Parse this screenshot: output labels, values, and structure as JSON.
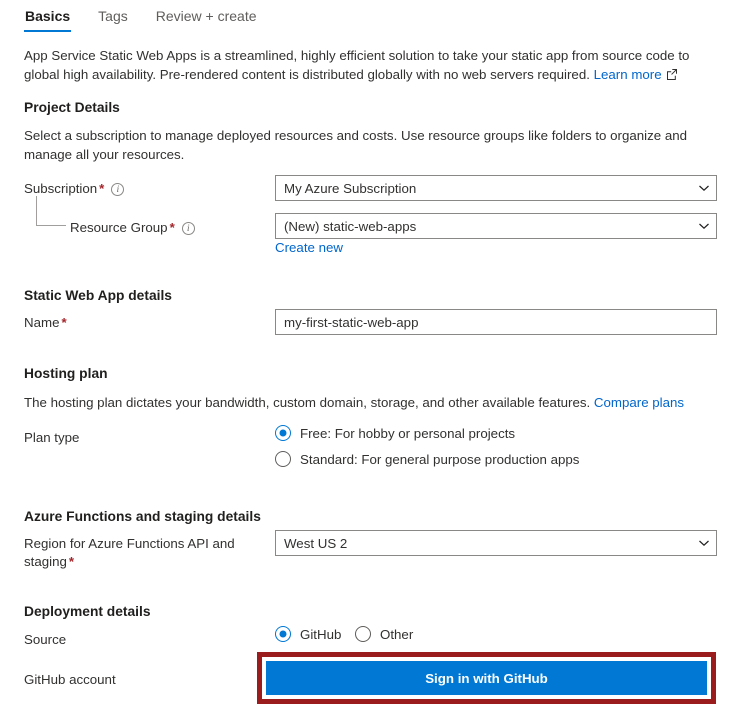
{
  "tabs": [
    {
      "label": "Basics",
      "active": true
    },
    {
      "label": "Tags",
      "active": false
    },
    {
      "label": "Review + create",
      "active": false
    }
  ],
  "intro": {
    "text": "App Service Static Web Apps is a streamlined, highly efficient solution to take your static app from source code to global high availability. Pre-rendered content is distributed globally with no web servers required.",
    "link_label": "Learn more",
    "link_icon": "external-link-icon"
  },
  "project_details": {
    "heading": "Project Details",
    "description": "Select a subscription to manage deployed resources and costs. Use resource groups like folders to organize and manage all your resources.",
    "subscription": {
      "label": "Subscription",
      "required": "*",
      "info_icon": "info-icon",
      "value": "My Azure Subscription"
    },
    "resource_group": {
      "label": "Resource Group",
      "required": "*",
      "info_icon": "info-icon",
      "value": "(New) static-web-apps",
      "create_new_label": "Create new"
    }
  },
  "app_details": {
    "heading": "Static Web App details",
    "name": {
      "label": "Name",
      "required": "*",
      "value": "my-first-static-web-app"
    }
  },
  "hosting_plan": {
    "heading": "Hosting plan",
    "description": "The hosting plan dictates your bandwidth, custom domain, storage, and other available features.",
    "compare_link": "Compare plans",
    "plan_type_label": "Plan type",
    "options": [
      {
        "label": "Free: For hobby or personal projects",
        "selected": true
      },
      {
        "label": "Standard: For general purpose production apps",
        "selected": false
      }
    ]
  },
  "functions_staging": {
    "heading": "Azure Functions and staging details",
    "region": {
      "label": "Region for Azure Functions API and staging",
      "required": "*",
      "value": "West US 2"
    }
  },
  "deployment": {
    "heading": "Deployment details",
    "source_label": "Source",
    "sources": [
      {
        "label": "GitHub",
        "selected": true
      },
      {
        "label": "Other",
        "selected": false
      }
    ],
    "github_account_label": "GitHub account",
    "sign_in_button": "Sign in with GitHub"
  },
  "colors": {
    "accent": "#0078d4",
    "link": "#0066cc",
    "required": "#a4262c",
    "highlight_border": "#9b1c1c",
    "text": "#323130"
  }
}
